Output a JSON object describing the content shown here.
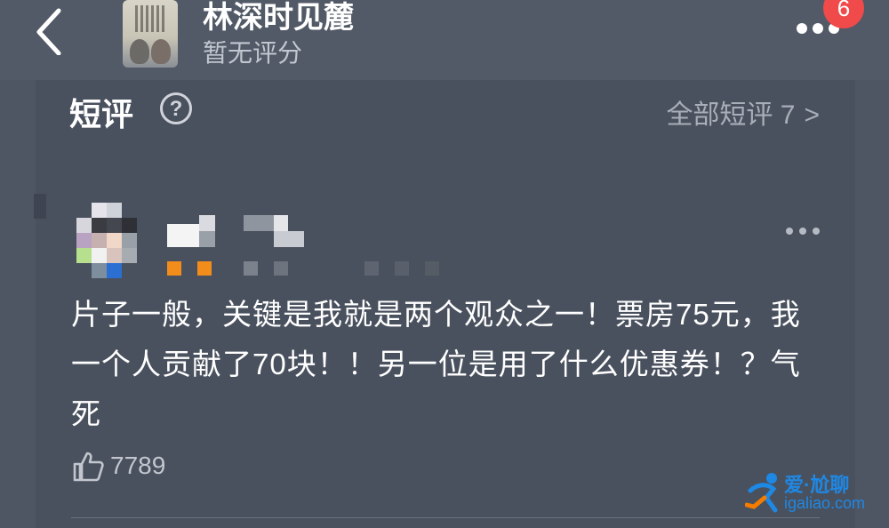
{
  "header": {
    "movie_title": "林深时见麓",
    "score_text": "暂无评分",
    "badge_count": "6"
  },
  "section": {
    "title": "短评",
    "all_link": "全部短评 7"
  },
  "review": {
    "text": "片子一般，关键是我就是两个观众之一！票房75元，我一个人贡献了70块！！另一位是用了什么优惠券！？气死",
    "likes": "7789"
  },
  "watermark": {
    "cn": "爱·尬聊",
    "url": "igaliao.com"
  },
  "colors": {
    "background": "#4f5663",
    "badge": "#f04a4a",
    "watermark_blue": "#1e88e5"
  },
  "icons": [
    "back-chevron-icon",
    "more-icon",
    "help-icon",
    "chevron-right-icon",
    "more-dots-icon",
    "thumbs-up-icon"
  ]
}
